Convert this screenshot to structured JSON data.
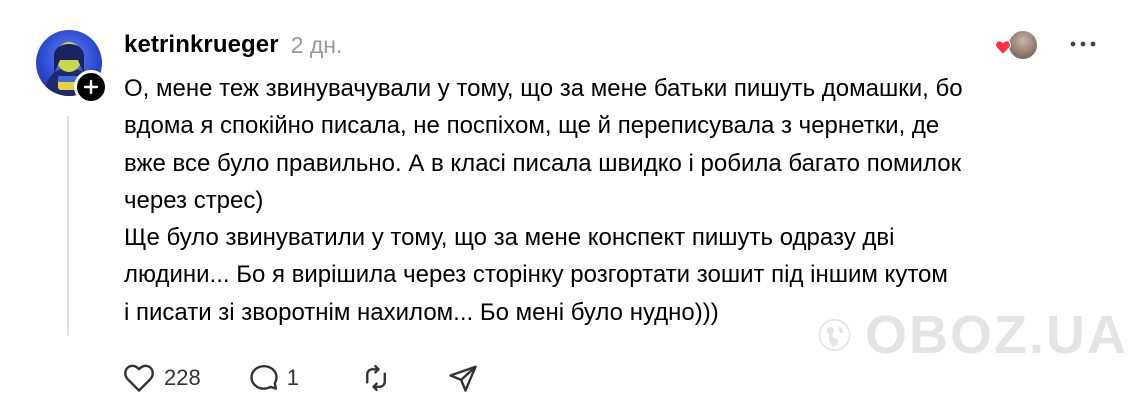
{
  "post": {
    "author": {
      "username": "ketrinkrueger",
      "avatar_icon": "user-avatar",
      "follow_icon": "plus-icon"
    },
    "time": "2 дн.",
    "liked_by": {
      "heart_icon": "heart-filled-icon",
      "heart_color": "#ff3040",
      "avatar_icon": "liker-avatar"
    },
    "more_icon": "more-horizontal-icon",
    "text_lines": [
      "О, мене теж звинувачували у тому, що за мене батьки пишуть домашки, бо",
      "вдома я спокійно писала, не поспіхом, ще й переписувала з чернетки, де",
      "вже все було правильно. А в класі писала швидко і робила багато помилок",
      "через стрес)",
      "Ще було звинуватили у тому, що за мене конспект пишуть одразу дві",
      "людини... Бо я вирішила через сторінку розгортати зошит під іншим кутом",
      "і писати зі зворотнім нахилом... Бо мені було нудно)))"
    ],
    "actions": {
      "like": {
        "icon": "heart-outline-icon",
        "count": "228"
      },
      "reply": {
        "icon": "comment-icon",
        "count": "1"
      },
      "repost": {
        "icon": "repost-icon"
      },
      "share": {
        "icon": "send-icon"
      }
    }
  },
  "watermark": {
    "text": "OBOZ.UA",
    "icon": "globe-logo-icon"
  },
  "colors": {
    "text": "#000000",
    "muted": "#999999",
    "thread_line": "#e1e1e1",
    "like_red": "#ff3040"
  }
}
